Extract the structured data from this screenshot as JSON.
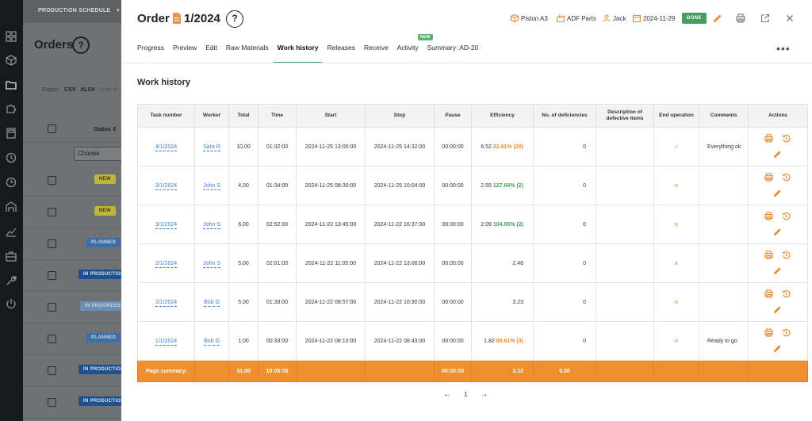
{
  "background_app": {
    "topbar_title": "PRODUCTION SCHEDULE",
    "page_title": "Orders",
    "help": "?",
    "export_label": "Export:",
    "export_csv": "CSV",
    "export_xlsx": "XLSX",
    "scan_label": "Scan fr",
    "status_header": "Status",
    "filter_placeholder": "Choose",
    "rows": [
      {
        "badge": "NEW",
        "kind": "new"
      },
      {
        "badge": "NEW",
        "kind": "new"
      },
      {
        "badge": "PLANNED",
        "kind": "planned"
      },
      {
        "badge": "IN PRODUCTION",
        "kind": "prod"
      },
      {
        "badge": "IN PROGRESS",
        "kind": "progress"
      },
      {
        "badge": "PLANNED",
        "kind": "planned"
      },
      {
        "badge": "IN PRODUCTION",
        "kind": "prod"
      },
      {
        "badge": "IN PRODUCTION",
        "kind": "prod"
      }
    ]
  },
  "modal": {
    "title": "Order",
    "order_number": "1/2024",
    "help": "?",
    "meta": {
      "product": "Piston A3",
      "department": "ADF Parts",
      "user": "Jack",
      "date": "2024-11-29"
    },
    "status_badge": "DONE",
    "tabs": [
      {
        "label": "Progress",
        "active": false
      },
      {
        "label": "Preview",
        "active": false
      },
      {
        "label": "Edit",
        "active": false
      },
      {
        "label": "Raw Materials",
        "active": false
      },
      {
        "label": "Work history",
        "active": true
      },
      {
        "label": "Releases",
        "active": false
      },
      {
        "label": "Receive",
        "active": false
      },
      {
        "label": "Activity",
        "active": false
      },
      {
        "label": "Summary: AD-20",
        "active": false
      }
    ],
    "new_pill": "NEW",
    "more": "•••",
    "section_title": "Work history"
  },
  "table": {
    "headers": [
      "Task number",
      "Worker",
      "Total",
      "Time",
      "Start",
      "Stop",
      "Pause",
      "Efficiency",
      "No. of deficiencies",
      "Description of defective items",
      "End operation",
      "Comments",
      "Actions"
    ],
    "rows": [
      {
        "task": "4/1/2024",
        "worker": "Sara R",
        "total": "10,00",
        "time": "01:32:00",
        "start": "2024-11-25 13:00:00",
        "stop": "2024-11-25 14:32:00",
        "pause": "00:00:00",
        "eff_value": "6.52",
        "eff_pct": "32.61% (20)",
        "eff_color": "orange",
        "deficiencies": "0",
        "description": "",
        "end_op": "check",
        "comments": "Everything ok"
      },
      {
        "task": "3/1/2024",
        "worker": "John S",
        "total": "4,00",
        "time": "01:34:00",
        "start": "2024-11-25 08:30:00",
        "stop": "2024-11-25 10:04:00",
        "pause": "00:00:00",
        "eff_value": "2.55",
        "eff_pct": "127.66% (2)",
        "eff_color": "green",
        "deficiencies": "0",
        "description": "",
        "end_op": "cross",
        "comments": ""
      },
      {
        "task": "3/1/2024",
        "worker": "John S",
        "total": "6,00",
        "time": "02:52:00",
        "start": "2024-11-22 13:45:00",
        "stop": "2024-11-22 16:37:00",
        "pause": "00:00:00",
        "eff_value": "2.09",
        "eff_pct": "104.65% (2)",
        "eff_color": "green",
        "deficiencies": "0",
        "description": "",
        "end_op": "cross",
        "comments": ""
      },
      {
        "task": "2/1/2024",
        "worker": "John S",
        "total": "5,00",
        "time": "02:01:00",
        "start": "2024-11-22 11:05:00",
        "stop": "2024-11-22 13:06:00",
        "pause": "00:00:00",
        "eff_value": "2.48",
        "eff_pct": "",
        "eff_color": "none",
        "deficiencies": "0",
        "description": "",
        "end_op": "cross",
        "comments": ""
      },
      {
        "task": "2/1/2024",
        "worker": "Bob G",
        "total": "5,00",
        "time": "01:33:00",
        "start": "2024-11-22 08:57:00",
        "stop": "2024-11-22 10:30:00",
        "pause": "00:00:00",
        "eff_value": "3.23",
        "eff_pct": "",
        "eff_color": "none",
        "deficiencies": "0",
        "description": "",
        "end_op": "cross",
        "comments": ""
      },
      {
        "task": "1/1/2024",
        "worker": "Bob G",
        "total": "1,00",
        "time": "00:33:00",
        "start": "2024-11-22 08:10:00",
        "stop": "2024-11-22 08:43:00",
        "pause": "00:00:00",
        "eff_value": "1.82",
        "eff_pct": "60.61% (3)",
        "eff_color": "orange",
        "deficiencies": "0",
        "description": "",
        "end_op": "cross",
        "comments": "Ready to go"
      }
    ],
    "summary": {
      "label": "Page summary:",
      "total": "31,00",
      "time": "10:05:00",
      "pause": "00:00:00",
      "efficiency": "3.12",
      "deficiencies": "0,00"
    },
    "end_op_symbols": {
      "check": "✓",
      "cross": "×"
    }
  },
  "pagination": {
    "prev": "←",
    "page": "1",
    "next": "→"
  },
  "colors": {
    "accent_orange": "#ee8e2e",
    "accent_green": "#43a05a",
    "link_blue": "#3b7fd8"
  }
}
